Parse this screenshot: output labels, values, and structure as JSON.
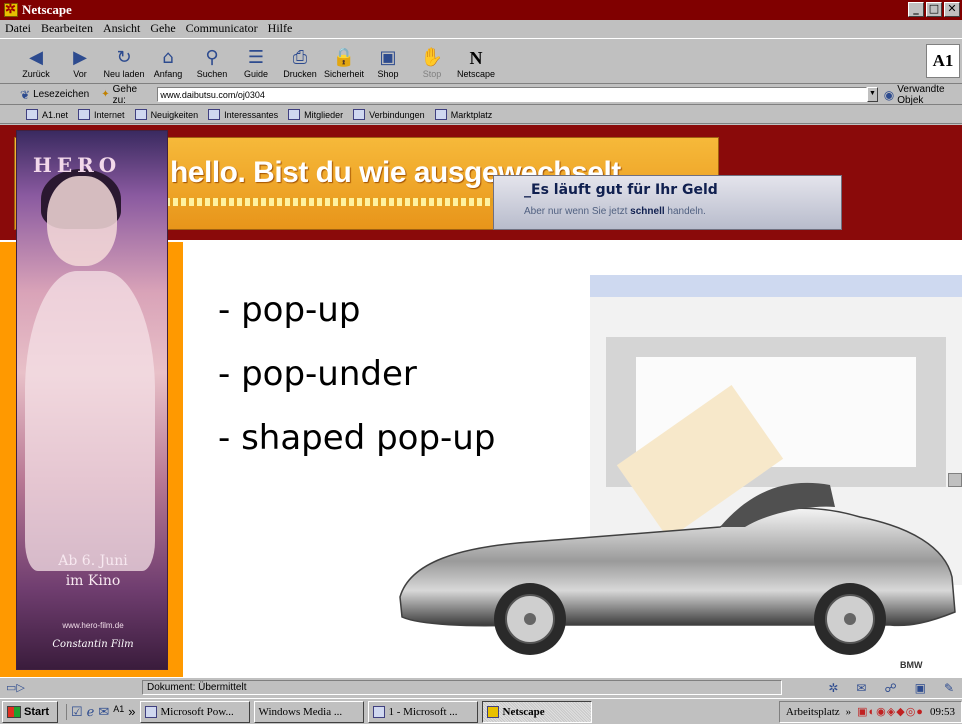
{
  "window": {
    "title": "Netscape",
    "buttons": [
      "_",
      "□",
      "✕"
    ]
  },
  "menu": [
    "Datei",
    "Bearbeiten",
    "Ansicht",
    "Gehe",
    "Communicator",
    "Hilfe"
  ],
  "toolbar": [
    {
      "label": "Zurück",
      "icon": "◀"
    },
    {
      "label": "Vor",
      "icon": "▶"
    },
    {
      "label": "Neu laden",
      "icon": "↻"
    },
    {
      "label": "Anfang",
      "icon": "⌂"
    },
    {
      "label": "Suchen",
      "icon": "⚲"
    },
    {
      "label": "Guide",
      "icon": "☰"
    },
    {
      "label": "Drucken",
      "icon": "⎙"
    },
    {
      "label": "Sicherheit",
      "icon": "🔒"
    },
    {
      "label": "Shop",
      "icon": "▣"
    },
    {
      "label": "Stop",
      "icon": "✋"
    },
    {
      "label": "Netscape",
      "icon": "N"
    }
  ],
  "toolbar_logo": "A1",
  "location": {
    "bookmarks_label": "Lesezeichen",
    "goto_label": "Gehe zu:",
    "url": "www.daibutsu.com/oj0304",
    "related_label": "Verwandte Objek"
  },
  "personal_toolbar": [
    "A1.net",
    "Internet",
    "Neuigkeiten",
    "Interessantes",
    "Mitglieder",
    "Verbindungen",
    "Marktplatz"
  ],
  "content": {
    "banner_text": "hello. Bist du wie ausgewechselt.",
    "geld_title": "_Es läuft gut für Ihr Geld",
    "geld_sub_pre": "Aber nur wenn Sie jetzt ",
    "geld_sub_bold": "schnell",
    "geld_sub_post": " handeln.",
    "hero_title": "HERO",
    "hero_date_1": "Ab 6. Juni",
    "hero_date_2": "im Kino",
    "hero_url": "www.hero-film.de",
    "hero_sig": "Constantin Film",
    "bullets": [
      "- pop-up",
      "- pop-under",
      "- shaped pop-up"
    ],
    "car_brand": "BMW"
  },
  "status": {
    "text": "Dokument: Übermittelt"
  },
  "taskbar": {
    "start": "Start",
    "tasks": [
      {
        "label": "Microsoft Pow...",
        "active": false
      },
      {
        "label": "Windows Media ...",
        "active": false
      },
      {
        "label": "1 - Microsoft ...",
        "active": false
      },
      {
        "label": "Netscape",
        "active": true
      }
    ],
    "tray_label": "Arbeitsplatz",
    "time": "09:53"
  },
  "colors": {
    "title_bar": "#800000",
    "banner_bg": "#8a0a0a",
    "orange_accent": "#ff9900"
  }
}
